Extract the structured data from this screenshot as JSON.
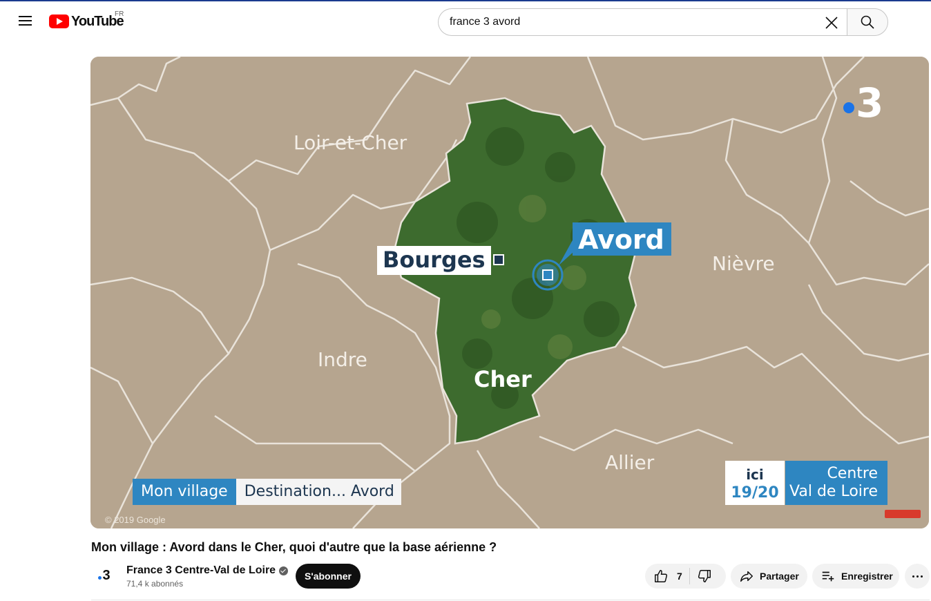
{
  "header": {
    "logo_text": "YouTube",
    "region_code": "FR",
    "search_value": "france 3 avord",
    "icons": {
      "menu": "hamburger-menu-icon",
      "clear": "close-icon",
      "search": "search-icon"
    }
  },
  "player": {
    "channel_logo": "3",
    "map_labels": {
      "loir_et_cher": "Loir-et-Cher",
      "indre": "Indre",
      "nievre": "Nièvre",
      "allier": "Allier",
      "cher": "Cher"
    },
    "cities": {
      "bourges": "Bourges",
      "avord": "Avord"
    },
    "lower_third": {
      "program": "Mon village",
      "topic": "Destination... Avord"
    },
    "ici_brand": {
      "logo": "ici",
      "time": "19/20"
    },
    "region": {
      "line1": "Centre",
      "line2": "Val de Loire"
    },
    "copyright": "© 2019 Google",
    "colors": {
      "accent_blue": "#2e86c1",
      "navy": "#1d3650",
      "land": "#b6a58f",
      "forest": "#3d6b2e"
    }
  },
  "video": {
    "title": "Mon village : Avord dans le Cher, quoi d'autre que la base aérienne ?",
    "channel": {
      "avatar_text": "3",
      "name": "France 3 Centre-Val de Loire",
      "subscribers": "71,4 k abonnés"
    },
    "subscribe_label": "S'abonner",
    "likes": "7",
    "share_label": "Partager",
    "save_label": "Enregistrer"
  }
}
